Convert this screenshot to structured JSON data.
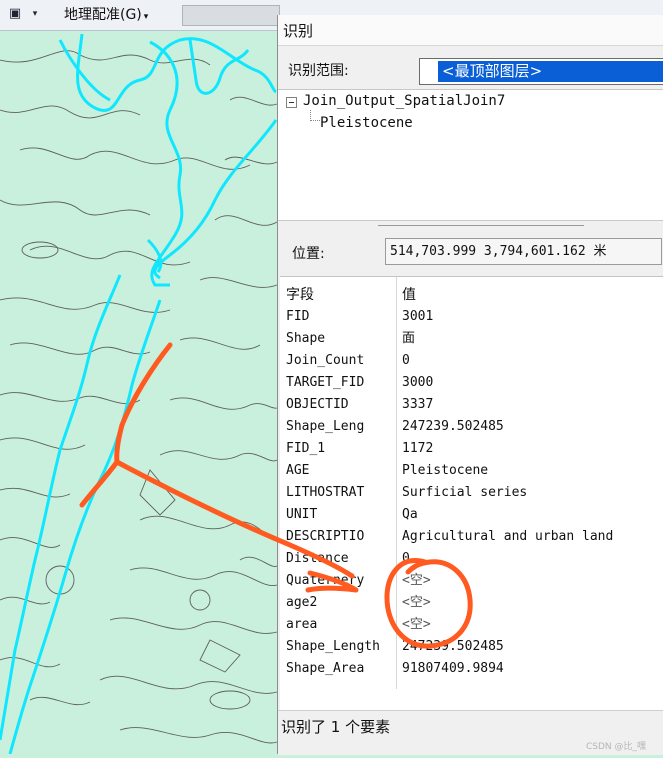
{
  "toolbar": {
    "georef_menu_label": "地理配准(G)",
    "georef_chevron_icon": "chevron-down-icon",
    "left_icons": [
      "layers-icon",
      "dropdown-icon"
    ]
  },
  "identify": {
    "title": "识别",
    "scope_label": "识别范围:",
    "scope_value": "<最顶部图层>",
    "tree": {
      "root": "Join_Output_SpatialJoin7",
      "child": "Pleistocene"
    },
    "location_label": "位置:",
    "location_value": "514,703.999  3,794,601.162 米",
    "columns": {
      "field": "字段",
      "value": "值"
    },
    "rows": [
      {
        "field": "FID",
        "value": "3001"
      },
      {
        "field": "Shape",
        "value": "面"
      },
      {
        "field": "Join_Count",
        "value": "0"
      },
      {
        "field": "TARGET_FID",
        "value": "3000"
      },
      {
        "field": "OBJECTID",
        "value": "3337"
      },
      {
        "field": "Shape_Leng",
        "value": "247239.502485"
      },
      {
        "field": "FID_1",
        "value": "1172"
      },
      {
        "field": "AGE",
        "value": "Pleistocene"
      },
      {
        "field": "LITHOSTRAT",
        "value": "Surficial series"
      },
      {
        "field": "UNIT",
        "value": "Qa"
      },
      {
        "field": "DESCRIPTIO",
        "value": "Agricultural and urban land"
      },
      {
        "field": "Distance",
        "value": "0"
      },
      {
        "field": "Quaternery",
        "value": "<空>"
      },
      {
        "field": "age2",
        "value": "<空>"
      },
      {
        "field": "area",
        "value": "<空>"
      },
      {
        "field": "Shape_Length",
        "value": "247239.502485"
      },
      {
        "field": "Shape_Area",
        "value": "91807409.9894"
      }
    ],
    "status_text": "识别了 1 个要素"
  },
  "watermark": "CSDN @比_嘿",
  "colors": {
    "map_fill": "#c8f0dc",
    "map_lines": "#5a5a5a",
    "selected_outline": "#00e5ff",
    "annotation": "#ff5a1f",
    "selection_blue": "#0a5fd6"
  }
}
